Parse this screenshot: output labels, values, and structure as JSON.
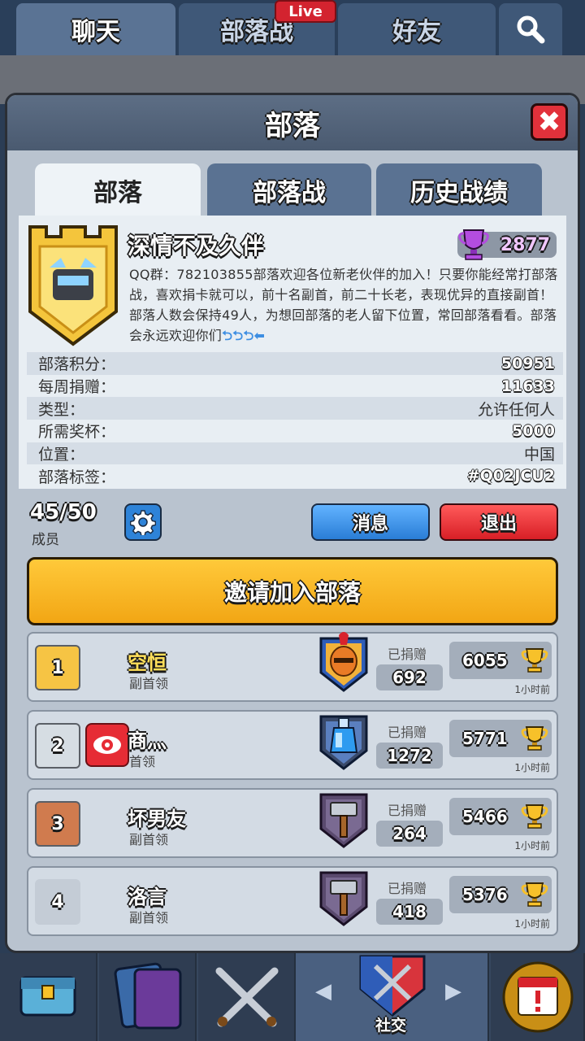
{
  "top_tabs": [
    {
      "label": "聊天"
    },
    {
      "label": "部落战"
    },
    {
      "label": "好友"
    }
  ],
  "live_badge": "Live",
  "modal": {
    "title": "部落",
    "close_label": "✖"
  },
  "inner_tabs": [
    {
      "label": "部落"
    },
    {
      "label": "部落战"
    },
    {
      "label": "历史战绩"
    }
  ],
  "clan": {
    "name": "深情不及久伴",
    "trophies": "2877",
    "description": "QQ群：782103855部落欢迎各位新老伙伴的加入！只要你能经常打部落战，喜欢捐卡就可以，前十名副首，前二十长老，表现优异的直接副首！部落人数会保持49人，为想回部落的老人留下位置，常回部落看看。部落会永远欢迎你们",
    "description_arrows": "⮌⮌⮌⬅",
    "stats": [
      {
        "label": "部落积分：",
        "value": "50951"
      },
      {
        "label": "每周捐赠：",
        "value": "11633"
      },
      {
        "label": "类型：",
        "value": "允许任何人"
      },
      {
        "label": "所需奖杯：",
        "value": "5000"
      },
      {
        "label": "位置：",
        "value": "中国"
      },
      {
        "label": "部落标签：",
        "value": "#Q02JCU2"
      }
    ]
  },
  "members_bar": {
    "count": "45/50",
    "label": "成员",
    "message_button": "消息",
    "exit_button": "退出"
  },
  "invite_button": "邀请加入部落",
  "members": [
    {
      "rank": "1",
      "name": "空恒",
      "role": "副首领",
      "donated_label": "已捐赠",
      "donated": "692",
      "trophies": "6055",
      "time": "1小时前",
      "rank_color": "#f6c444",
      "arena": "knight-arena-icon"
    },
    {
      "rank": "2",
      "name": "商灬",
      "role": "首领",
      "donated_label": "已捐赠",
      "donated": "1272",
      "trophies": "5771",
      "time": "1小时前",
      "rank_color": "#d6dde3",
      "arena": "potion-arena-icon"
    },
    {
      "rank": "3",
      "name": "坏男友",
      "role": "副首领",
      "donated_label": "已捐赠",
      "donated": "264",
      "trophies": "5466",
      "time": "1小时前",
      "rank_color": "#d07b4e",
      "arena": "hammer-arena-icon"
    },
    {
      "rank": "4",
      "name": "洛言",
      "role": "副首领",
      "donated_label": "已捐赠",
      "donated": "418",
      "trophies": "5376",
      "time": "1小时前",
      "rank_color": "#c4ccd6",
      "arena": "hammer-arena-icon"
    }
  ],
  "bottom_nav": {
    "social_label": "社交"
  }
}
